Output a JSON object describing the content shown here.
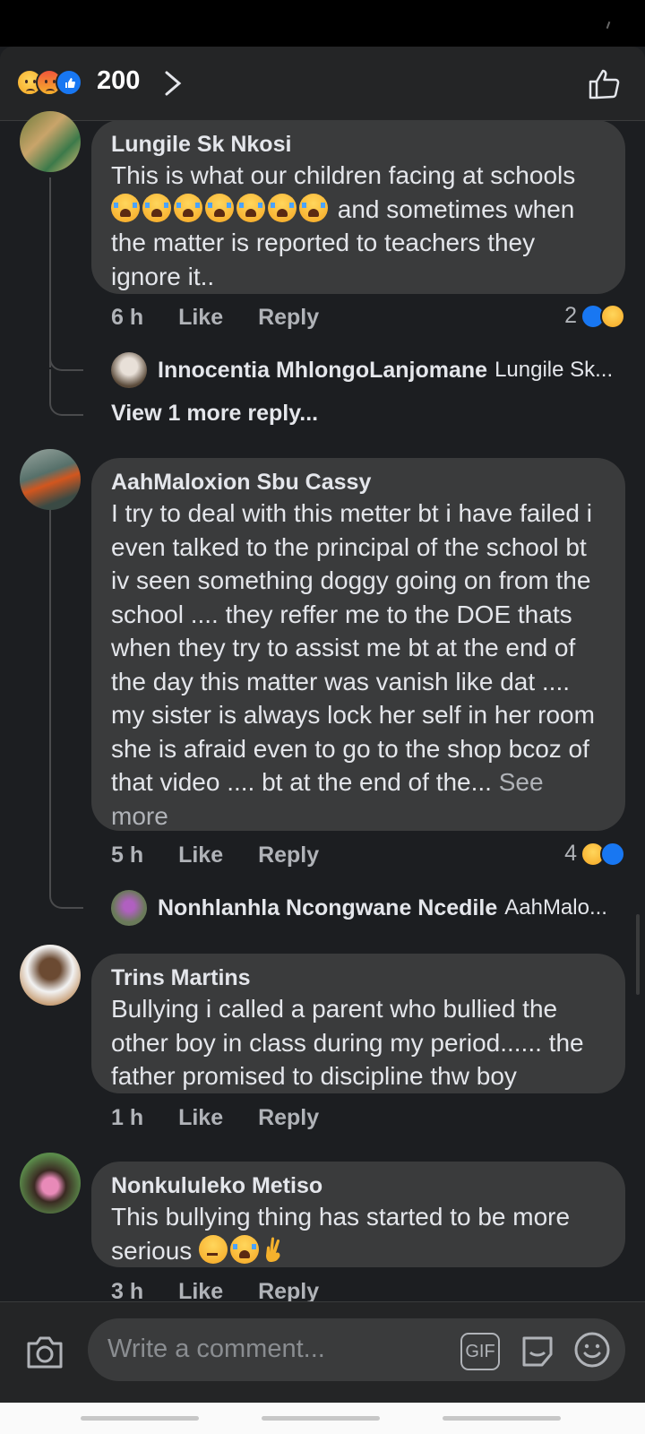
{
  "header": {
    "reaction_icons": [
      "sad-reaction-icon",
      "angry-reaction-icon",
      "like-reaction-icon"
    ],
    "reaction_count": "200"
  },
  "comments": [
    {
      "author": "Lungile Sk Nkosi",
      "text_a": "This is what our children facing at schools ",
      "emoji": "😭😭😭😭😭😭😭",
      "text_b": " and sometimes when the matter is reported to teachers they ignore it..",
      "time": "6 h",
      "like": "Like",
      "reply": "Reply",
      "reactions": "2",
      "reply_preview": {
        "name": "Innocentia MhlongoLanjomane",
        "snippet": "Lungile Sk..."
      },
      "more_replies": "View 1 more reply..."
    },
    {
      "author": "AahMaloxion Sbu Cassy",
      "text": "I try to deal  with this metter bt i have failed i even talked to the principal of the school bt iv seen something doggy going on from the school .... they reffer me to the DOE thats when they try to assist me bt at the end of the day this matter was vanish like dat .... my sister is always lock her self in her room she is afraid even to go to the shop bcoz of that video  .... bt at the end of the...",
      "see_more": "See more",
      "time": "5 h",
      "like": "Like",
      "reply": "Reply",
      "reactions": "4",
      "reply_preview": {
        "name": "Nonhlanhla Ncongwane Ncedile",
        "snippet": "AahMalo..."
      }
    },
    {
      "author": "Trins Martins",
      "text": "Bullying i called a parent who bullied the other boy in class during my period...... the father promised to discipline thw boy",
      "time": "1 h",
      "like": "Like",
      "reply": "Reply"
    },
    {
      "author": "Nonkululeko Metiso",
      "text": "This bullying thing has started to be more serious ",
      "time": "3 h",
      "like": "Like",
      "reply": "Reply"
    }
  ],
  "composer": {
    "placeholder": "Write a comment...",
    "gif_label": "GIF"
  }
}
